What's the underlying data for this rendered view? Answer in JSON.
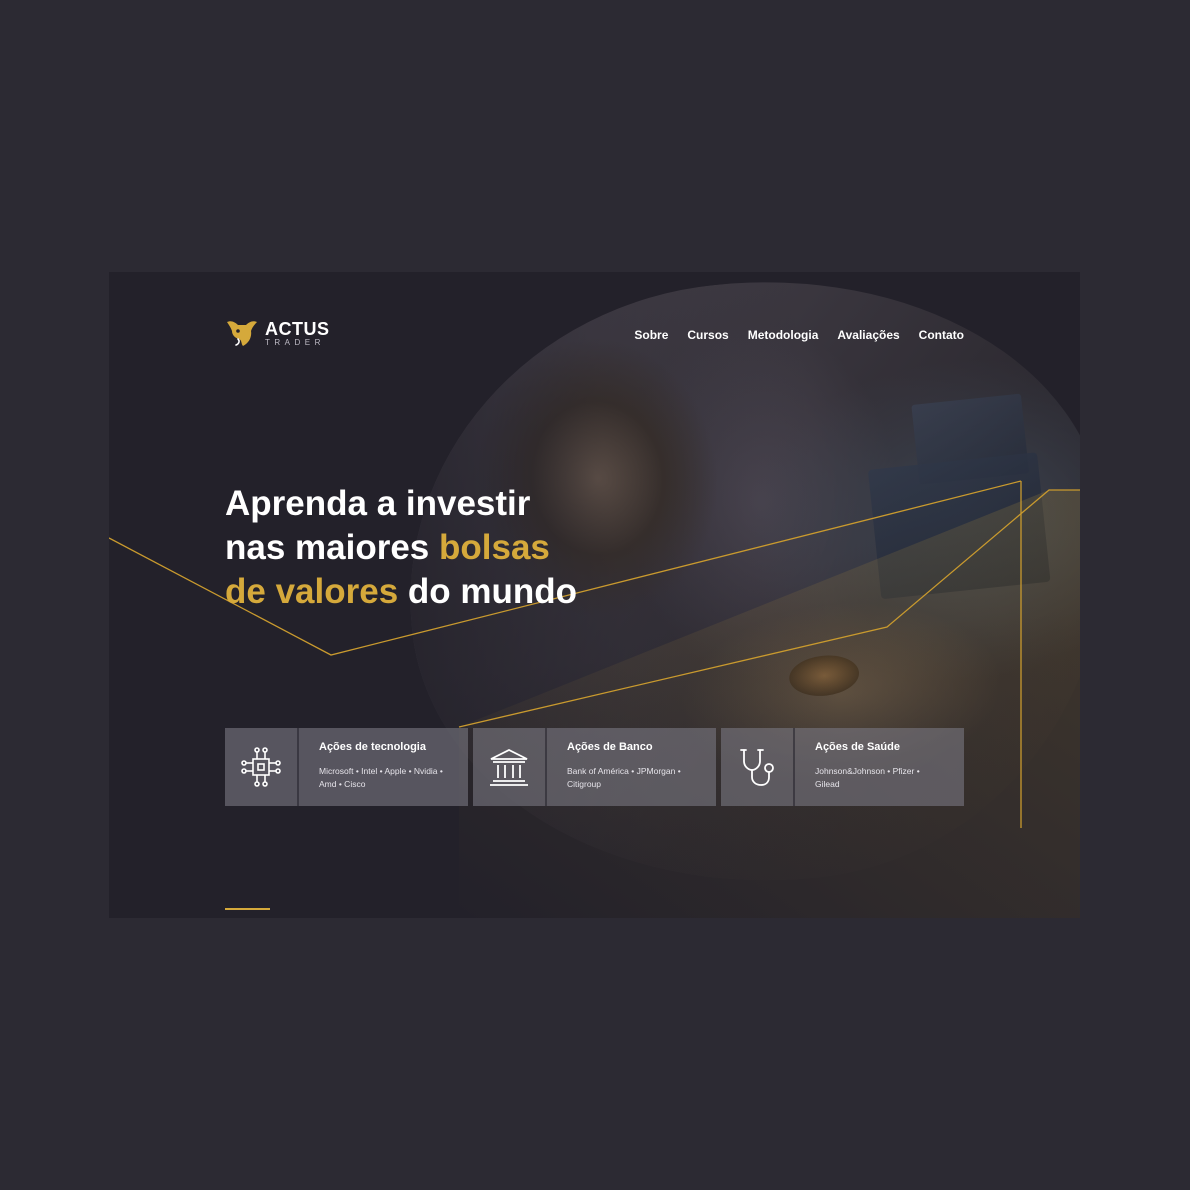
{
  "brand": {
    "name": "ACTUS",
    "tagline": "TRADER",
    "accent_color": "#d5a93b",
    "logo_icon": "bull-head-icon"
  },
  "nav": {
    "items": [
      {
        "label": "Sobre"
      },
      {
        "label": "Cursos"
      },
      {
        "label": "Metodologia"
      },
      {
        "label": "Avaliações"
      },
      {
        "label": "Contato"
      }
    ]
  },
  "hero": {
    "line1": "Aprenda a investir",
    "line2_white": "nas maiores ",
    "line2_gold": "bolsas",
    "line3_gold": "de valores",
    "line3_white": " do mundo"
  },
  "cards": [
    {
      "icon": "circuit-chip-icon",
      "title": "Ações de tecnologia",
      "desc": "Microsoft • Intel • Apple • Nvidia • Amd • Cisco"
    },
    {
      "icon": "bank-building-icon",
      "title": "Ações de Banco",
      "desc": "Bank of América • JPMorgan • Citigroup"
    },
    {
      "icon": "stethoscope-icon",
      "title": "Ações de Saúde",
      "desc": "Johnson&Johnson • Pfizer • Gilead"
    }
  ]
}
